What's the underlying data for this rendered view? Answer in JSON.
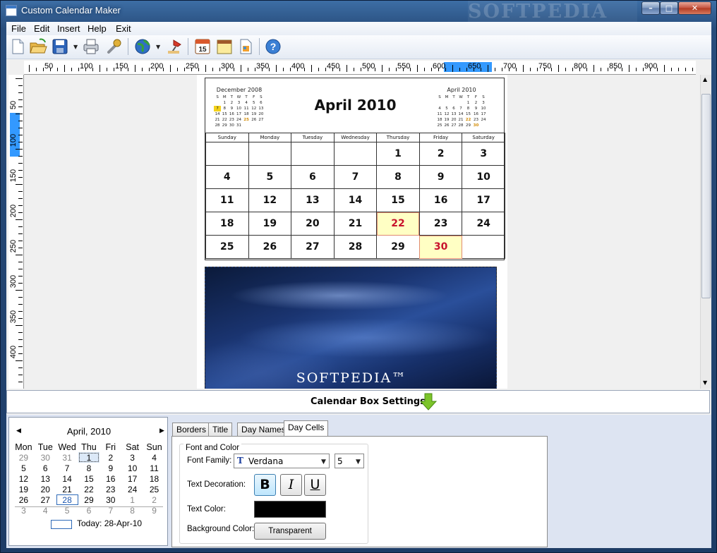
{
  "window": {
    "title": "Custom Calendar Maker",
    "watermark": "SOFTPEDIA",
    "min_glyph": "–",
    "max_glyph": "□",
    "close_glyph": "✕"
  },
  "menu": [
    "File",
    "Edit",
    "Insert",
    "Help",
    "Exit"
  ],
  "toolbar_icons": [
    "new-document-icon",
    "open-folder-icon",
    "save-icon",
    "print-icon",
    "wrench-icon",
    "globe-icon",
    "pin-icon",
    "calendar-15-icon",
    "notepad-icon",
    "image-icon",
    "help-icon"
  ],
  "toolbar_calendar_digit": "15",
  "toolbar_help_glyph": "?",
  "ruler": {
    "h_labels": [
      "50",
      "100",
      "150",
      "200",
      "250",
      "300",
      "350",
      "400",
      "450",
      "500",
      "550",
      "600",
      "650",
      "700",
      "750",
      "800",
      "850",
      "900"
    ],
    "v_labels": [
      "50",
      "100",
      "150",
      "200",
      "250",
      "300",
      "350",
      "400"
    ],
    "highlight_color": "#3399ff"
  },
  "calendar": {
    "title": "April 2010",
    "mini_left": {
      "title": "December 2008",
      "days": [
        "S",
        "M",
        "T",
        "W",
        "T",
        "F",
        "S"
      ],
      "weeks": [
        [
          "",
          "1",
          "2",
          "3",
          "4",
          "5",
          "6"
        ],
        [
          "7",
          "8",
          "9",
          "10",
          "11",
          "12",
          "13"
        ],
        [
          "14",
          "15",
          "16",
          "17",
          "18",
          "19",
          "20"
        ],
        [
          "21",
          "22",
          "23",
          "24",
          "25",
          "26",
          "27"
        ],
        [
          "28",
          "29",
          "30",
          "31",
          "",
          "",
          ""
        ]
      ]
    },
    "mini_right": {
      "title": "April 2010",
      "days": [
        "S",
        "M",
        "T",
        "W",
        "T",
        "F",
        "S"
      ],
      "weeks": [
        [
          "",
          "",
          "",
          "",
          "1",
          "2",
          "3"
        ],
        [
          "4",
          "5",
          "6",
          "7",
          "8",
          "9",
          "10"
        ],
        [
          "11",
          "12",
          "13",
          "14",
          "15",
          "16",
          "17"
        ],
        [
          "18",
          "19",
          "20",
          "21",
          "22",
          "23",
          "24"
        ],
        [
          "25",
          "26",
          "27",
          "28",
          "29",
          "30",
          ""
        ]
      ]
    },
    "weekdays": [
      "Sunday",
      "Monday",
      "Tuesday",
      "Wednesday",
      "Thursday",
      "Friday",
      "Saturday"
    ],
    "weeks": [
      [
        "",
        "",
        "",
        "",
        "1",
        "2",
        "3"
      ],
      [
        "4",
        "5",
        "6",
        "7",
        "8",
        "9",
        "10"
      ],
      [
        "11",
        "12",
        "13",
        "14",
        "15",
        "16",
        "17"
      ],
      [
        "18",
        "19",
        "20",
        "21",
        "22",
        "23",
        "24"
      ],
      [
        "25",
        "26",
        "27",
        "28",
        "29",
        "30",
        ""
      ]
    ],
    "highlight_color": "#c8122c",
    "image_watermark": "SOFTPEDIA™"
  },
  "settings": {
    "title": "Calendar Box Settings"
  },
  "date_picker": {
    "month": "April, 2010",
    "prev": "◀",
    "next": "▶",
    "days": [
      "Mon",
      "Tue",
      "Wed",
      "Thu",
      "Fri",
      "Sat",
      "Sun"
    ],
    "weeks": [
      [
        "29",
        "30",
        "31",
        "1",
        "2",
        "3",
        "4"
      ],
      [
        "5",
        "6",
        "7",
        "8",
        "9",
        "10",
        "11"
      ],
      [
        "12",
        "13",
        "14",
        "15",
        "16",
        "17",
        "18"
      ],
      [
        "19",
        "20",
        "21",
        "22",
        "23",
        "24",
        "25"
      ],
      [
        "26",
        "27",
        "28",
        "29",
        "30",
        "1",
        "2"
      ],
      [
        "3",
        "4",
        "5",
        "6",
        "7",
        "8",
        "9"
      ]
    ],
    "today": "Today: 28-Apr-10"
  },
  "tabs": [
    "Borders",
    "Title",
    "Day Names",
    "Day Cells"
  ],
  "font_color": {
    "group_label": "Font and Color",
    "font_family_label": "Font Family:",
    "font_family_icon": "T",
    "font_family": "Verdana",
    "font_size": "5",
    "text_decoration_label": "Text Decoration:",
    "bold": "B",
    "italic": "I",
    "underline": "U",
    "text_color_label": "Text Color:",
    "text_color": "#000000",
    "bg_color_label": "Background Color:",
    "bg_button": "Transparent"
  }
}
